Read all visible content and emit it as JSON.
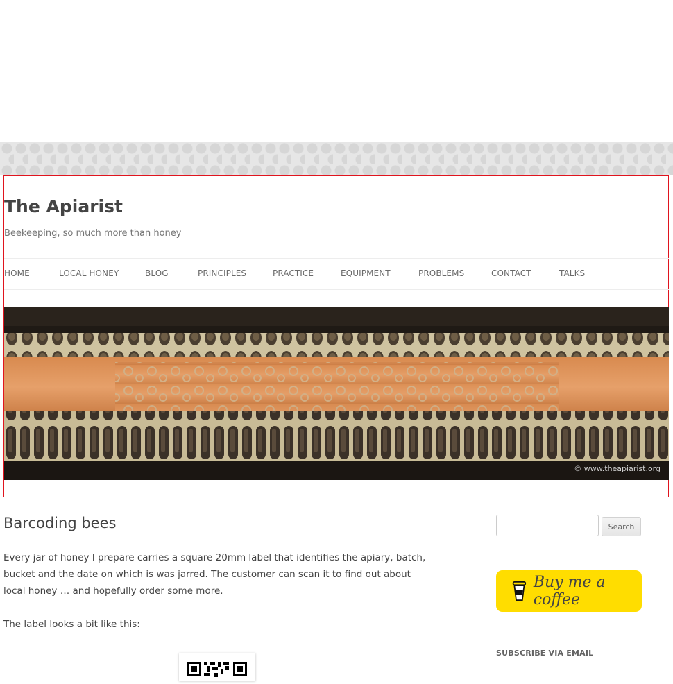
{
  "site": {
    "title": "The Apiarist",
    "description": "Beekeeping, so much more than honey"
  },
  "nav": {
    "items": [
      {
        "label": "HOME"
      },
      {
        "label": "LOCAL HONEY"
      },
      {
        "label": "BLOG"
      },
      {
        "label": "PRINCIPLES"
      },
      {
        "label": "PRACTICE"
      },
      {
        "label": "EQUIPMENT"
      },
      {
        "label": "PROBLEMS"
      },
      {
        "label": "CONTACT"
      },
      {
        "label": "TALKS"
      }
    ]
  },
  "banner": {
    "credit": "© www.theapiarist.org"
  },
  "post": {
    "title": "Barcoding bees",
    "paragraphs": [
      "Every jar of honey I prepare carries a square 20mm label that identifies the apiary, batch, bucket and the date on which is was jarred. The customer can scan it to find out about local honey … and hopefully order some more.",
      "The label looks a bit like this:"
    ]
  },
  "sidebar": {
    "search_button": "Search",
    "coffee_label": "Buy me a coffee",
    "subscribe_title": "SUBSCRIBE VIA EMAIL"
  },
  "colors": {
    "accent_border": "#e0141e",
    "coffee_bg": "#ffdd00"
  }
}
